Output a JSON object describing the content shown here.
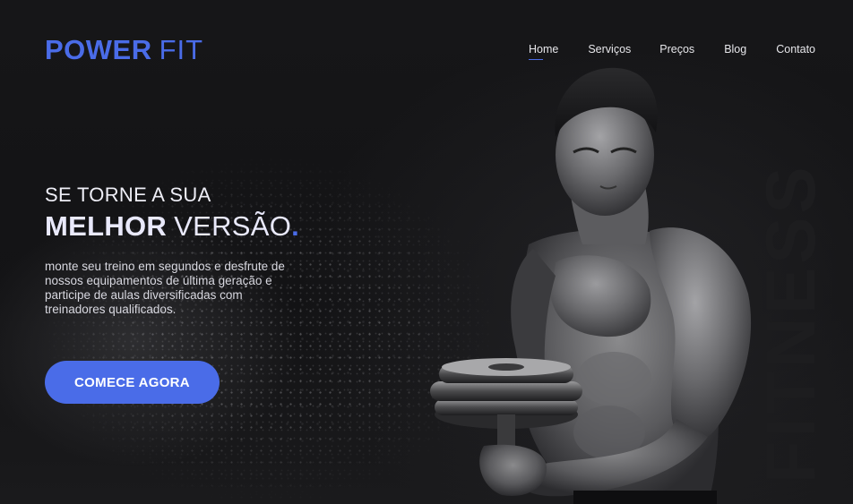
{
  "brand": {
    "name_bold": "POWER",
    "name_light": "FIT",
    "accent_color": "#4a6ce8"
  },
  "nav": {
    "items": [
      {
        "label": "Home",
        "active": true
      },
      {
        "label": "Serviços",
        "active": false
      },
      {
        "label": "Preços",
        "active": false
      },
      {
        "label": "Blog",
        "active": false
      },
      {
        "label": "Contato",
        "active": false
      }
    ]
  },
  "hero": {
    "kicker": "SE TORNE A SUA",
    "title_bold": "MELHOR",
    "title_light": "VERSÃO",
    "title_dot": ".",
    "description": "monte seu treino em segundos e desfrute de nossos equipamentos de última geração e participe de aulas diversificadas com treinadores qualificados.",
    "cta_label": "COMECE AGORA"
  },
  "background": {
    "watermark_text": "FITNESS",
    "image": "bodybuilder-with-dumbbell"
  }
}
